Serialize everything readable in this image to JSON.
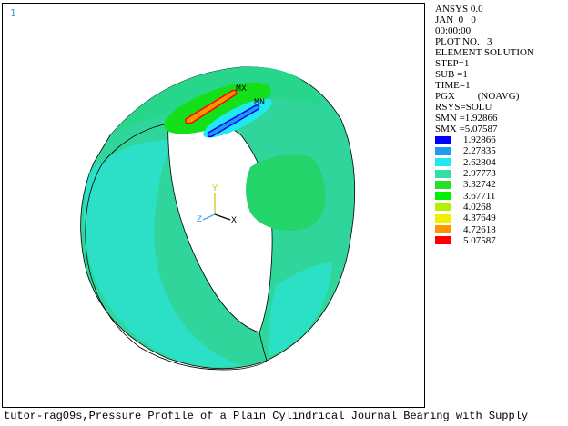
{
  "window_number": "1",
  "legend": {
    "header_lines": [
      "ANSYS 0.0",
      "JAN  0   0",
      "00:00:00",
      "PLOT NO.   3",
      "ELEMENT SOLUTION",
      "STEP=1",
      "SUB =1",
      "TIME=1",
      "PGX         (NOAVG)",
      "RSYS=SOLU",
      "SMN =1.92866",
      "SMX =5.07587"
    ],
    "contours": [
      {
        "value": "1.92866",
        "color": "#0000ff"
      },
      {
        "value": "2.27835",
        "color": "#1e9cf0"
      },
      {
        "value": "2.62804",
        "color": "#22e8f0"
      },
      {
        "value": "2.97773",
        "color": "#32e0a6"
      },
      {
        "value": "3.32742",
        "color": "#28e028"
      },
      {
        "value": "3.67711",
        "color": "#00f000"
      },
      {
        "value": "4.0268",
        "color": "#b4f000"
      },
      {
        "value": "4.37649",
        "color": "#f0f000"
      },
      {
        "value": "4.72618",
        "color": "#ff9400"
      },
      {
        "value": "5.07587",
        "color": "#ff0000"
      }
    ]
  },
  "model": {
    "max_label": "MX",
    "min_label": "MN",
    "triad_x_label": "X",
    "triad_y_label": "Y",
    "triad_z_label": "Z",
    "colors": {
      "base": "#2fd59a",
      "low_zone": "#2ce2d0",
      "mid_zone": "#22d46a",
      "high_zone": "#14e01a",
      "rim_outline": "#000000"
    }
  },
  "caption": "tutor-rag09s,Pressure Profile of a Plain Cylindrical Journal Bearing with Supply"
}
